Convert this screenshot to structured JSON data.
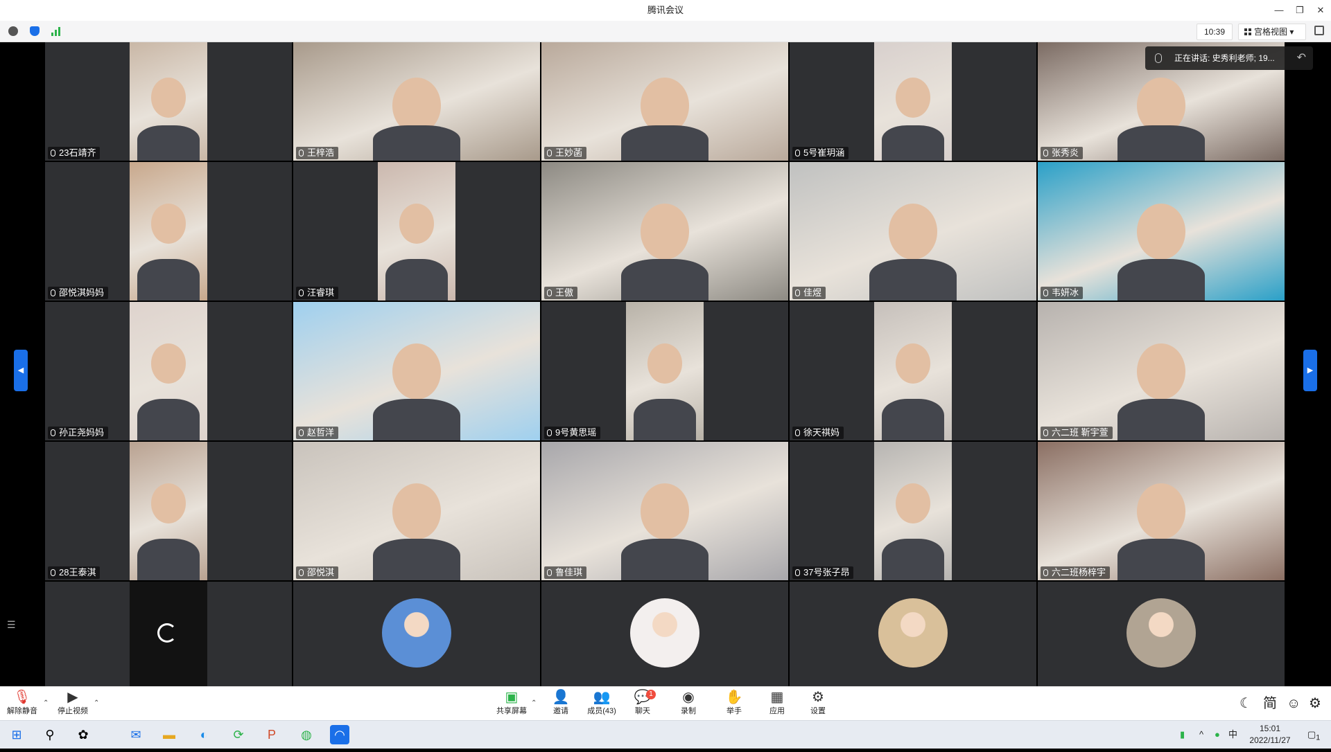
{
  "window": {
    "title": "腾讯会议",
    "minimize": "—",
    "maximize": "❐",
    "close": "✕"
  },
  "toolbar": {
    "icons": [
      "info-icon",
      "shield-icon",
      "signal-icon"
    ],
    "time": "10:39",
    "view_label": "宫格视图",
    "view_caret": "▾"
  },
  "speaking": {
    "text": "正在讲话: 史秀利老师; 19...",
    "back": "↶"
  },
  "side": {
    "left_arrow": "◀",
    "right_arrow": "▶",
    "list_icon": "☰"
  },
  "participants": [
    {
      "name": "23石靖齐",
      "bg": "#c9b7a6"
    },
    {
      "name": "王梓浩",
      "bg": "#a89a8b"
    },
    {
      "name": "王妙菡",
      "bg": "#b9a99b"
    },
    {
      "name": "5号崔玥涵",
      "bg": "#d8d0cd"
    },
    {
      "name": "张秀炎",
      "bg": "#7b6b63"
    },
    {
      "name": "邵悦淇妈妈",
      "bg": "#c8a88c"
    },
    {
      "name": "汪睿琪",
      "bg": "#cbb8ae"
    },
    {
      "name": "王傲",
      "bg": "#8d8a83"
    },
    {
      "name": "佳煜",
      "bg": "#c0c1c0"
    },
    {
      "name": "韦妍冰",
      "bg": "#2aa0c8"
    },
    {
      "name": "孙正尧妈妈",
      "bg": "#ded3cd"
    },
    {
      "name": "赵哲洋",
      "bg": "#9fd0ef"
    },
    {
      "name": "9号黄思瑶",
      "bg": "#b8b2a8"
    },
    {
      "name": "徐天祺妈",
      "bg": "#c6c0bb"
    },
    {
      "name": "六二班 靳宇萱",
      "bg": "#b7b2ae"
    },
    {
      "name": "28王泰淇",
      "bg": "#b9a291"
    },
    {
      "name": "邵悦淇",
      "bg": "#c9c3bc"
    },
    {
      "name": "鲁佳琪",
      "bg": "#a8a7ab"
    },
    {
      "name": "37号张子昂",
      "bg": "#b7b5b2"
    },
    {
      "name": "六二班杨梓宇",
      "bg": "#8b6f63"
    }
  ],
  "avatars": [
    {
      "icon": "cartoon-pig-rabbit-avatar",
      "bg": "#5b8fd6"
    },
    {
      "icon": "anime-girl-avatar",
      "bg": "#f3efee"
    },
    {
      "icon": "cartoon-character-avatar",
      "bg": "#d9c09a"
    },
    {
      "icon": "child-photo-avatar",
      "bg": "#b1a493"
    }
  ],
  "controls": {
    "unmute": "解除静音",
    "stop_video": "停止视频",
    "share": "共享屏幕",
    "invite": "邀请",
    "members": "成员(43)",
    "chat": "聊天",
    "chat_badge": "1",
    "record": "录制",
    "raise_hand": "举手",
    "apps": "应用",
    "settings": "设置",
    "caret": "⌃"
  },
  "ime": {
    "moon": "☾",
    "simplified": "简",
    "emoji": "☺",
    "gear": "⚙"
  },
  "taskbar": {
    "input_lang": "中",
    "time": "15:01",
    "date": "2022/11/27",
    "notif_count": "1",
    "apps": [
      "windows-start-icon",
      "search-icon",
      "app-icon",
      "mail-icon",
      "folder-icon",
      "edge-icon",
      "refresh-app-icon",
      "powerpoint-icon",
      "wechat-icon",
      "tencent-meeting-icon"
    ]
  },
  "colors": {
    "accent": "#1a6fe8",
    "tile_bg": "#2f3033",
    "badge": "#f04c3e"
  }
}
